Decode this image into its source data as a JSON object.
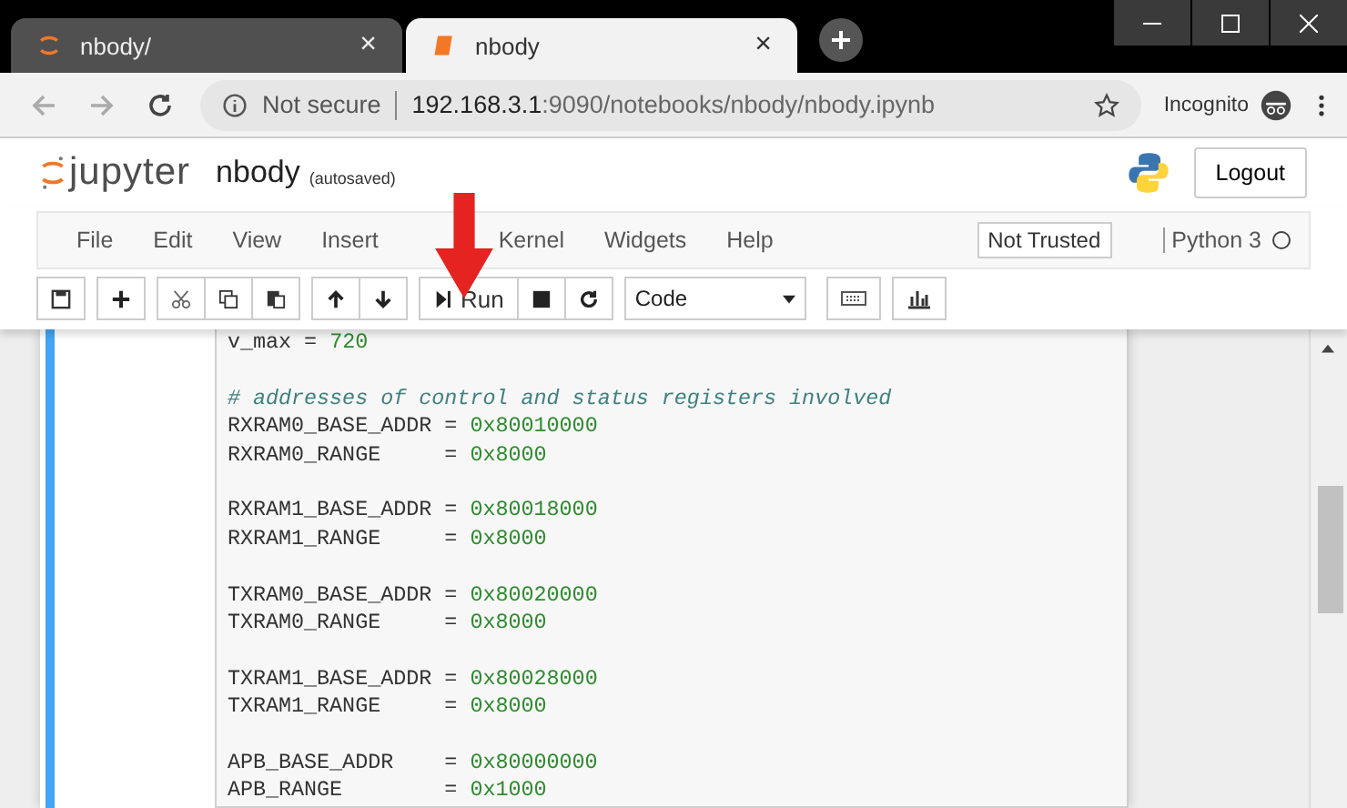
{
  "browser": {
    "tabs": [
      {
        "label": "nbody/",
        "selected": false,
        "close": "×"
      },
      {
        "label": "nbody",
        "selected": true,
        "close": "×"
      }
    ],
    "url": {
      "security": "Not secure",
      "host": "192.168.3.1",
      "path": ":9090/notebooks/nbody/nbody.ipynb"
    },
    "profile": "Incognito"
  },
  "header": {
    "brand": "jupyter",
    "title": "nbody",
    "status": "(autosaved)",
    "logout": "Logout"
  },
  "menu": [
    "File",
    "Edit",
    "View",
    "Insert",
    "Kernel",
    "Widgets",
    "Help"
  ],
  "trust": "Not Trusted",
  "kernel": {
    "name": "Python 3",
    "busy": false
  },
  "toolbar": [
    {
      "group": [
        {
          "kind": "save"
        }
      ]
    },
    {
      "group": [
        {
          "kind": "add"
        }
      ]
    },
    {
      "group": [
        {
          "kind": "cut"
        },
        {
          "kind": "copy"
        },
        {
          "kind": "paste"
        }
      ]
    },
    {
      "group": [
        {
          "kind": "up"
        },
        {
          "kind": "down"
        }
      ]
    },
    {
      "group": [
        {
          "kind": "run",
          "label": "Run"
        },
        {
          "kind": "stop"
        },
        {
          "kind": "restart"
        }
      ]
    }
  ],
  "cell_type": "Code",
  "code": [
    {
      "kind": "inline",
      "name": "v_max",
      "op": "=",
      "value": "720"
    },
    {
      "kind": "blank"
    },
    {
      "kind": "comment",
      "text": "# addresses of control and status registers involved"
    },
    {
      "kind": "assign",
      "name": "RXRAM0_BASE_ADDR",
      "op": "=",
      "value": "0x80010000"
    },
    {
      "kind": "assign",
      "name": "RXRAM0_RANGE",
      "op": "=",
      "value": "0x8000"
    },
    {
      "kind": "blank"
    },
    {
      "kind": "assign",
      "name": "RXRAM1_BASE_ADDR",
      "op": "=",
      "value": "0x80018000"
    },
    {
      "kind": "assign",
      "name": "RXRAM1_RANGE",
      "op": "=",
      "value": "0x8000"
    },
    {
      "kind": "blank"
    },
    {
      "kind": "assign",
      "name": "TXRAM0_BASE_ADDR",
      "op": "=",
      "value": "0x80020000"
    },
    {
      "kind": "assign",
      "name": "TXRAM0_RANGE",
      "op": "=",
      "value": "0x8000"
    },
    {
      "kind": "blank"
    },
    {
      "kind": "assign",
      "name": "TXRAM1_BASE_ADDR",
      "op": "=",
      "value": "0x80028000"
    },
    {
      "kind": "assign",
      "name": "TXRAM1_RANGE",
      "op": "=",
      "value": "0x8000"
    },
    {
      "kind": "blank"
    },
    {
      "kind": "assign",
      "name": "APB_BASE_ADDR",
      "op": "=",
      "value": "0x80000000"
    },
    {
      "kind": "assign",
      "name": "APB_RANGE",
      "op": "=",
      "value": "0x1000"
    }
  ]
}
